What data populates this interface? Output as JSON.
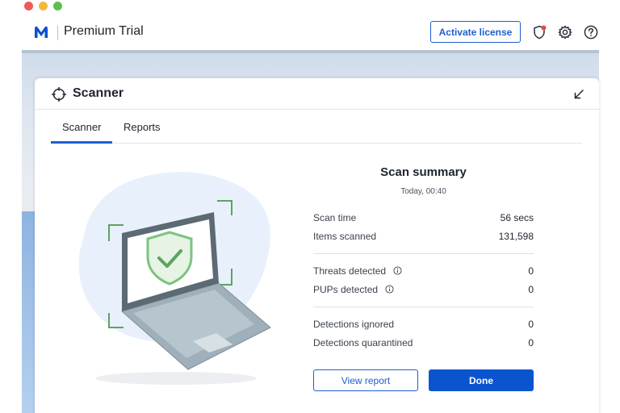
{
  "app": {
    "title": "Premium Trial",
    "activate_label": "Activate license",
    "icons": [
      "malwarebytes-logo",
      "shield-alert-icon",
      "gear-icon",
      "help-icon"
    ],
    "accent_color": "#1f5fd1",
    "alert_color": "#e5484d"
  },
  "panel": {
    "title": "Scanner",
    "icon": "crosshair-icon",
    "collapse_icon": "collapse-arrow-icon"
  },
  "tabs": [
    {
      "label": "Scanner",
      "active": true
    },
    {
      "label": "Reports",
      "active": false
    }
  ],
  "summary": {
    "title": "Scan summary",
    "date": "Today, 00:40",
    "groups": [
      [
        {
          "label": "Scan time",
          "value": "56 secs",
          "info": false
        },
        {
          "label": "Items scanned",
          "value": "131,598",
          "info": false
        }
      ],
      [
        {
          "label": "Threats detected",
          "value": "0",
          "info": true
        },
        {
          "label": "PUPs detected",
          "value": "0",
          "info": true
        }
      ],
      [
        {
          "label": "Detections ignored",
          "value": "0",
          "info": false
        },
        {
          "label": "Detections quarantined",
          "value": "0",
          "info": false
        }
      ]
    ]
  },
  "actions": {
    "view_report": "View report",
    "done": "Done"
  },
  "illustration": {
    "subject": "laptop-with-shield-check",
    "shield_color": "#7cc47f",
    "blob_color": "#e8f1fb"
  }
}
